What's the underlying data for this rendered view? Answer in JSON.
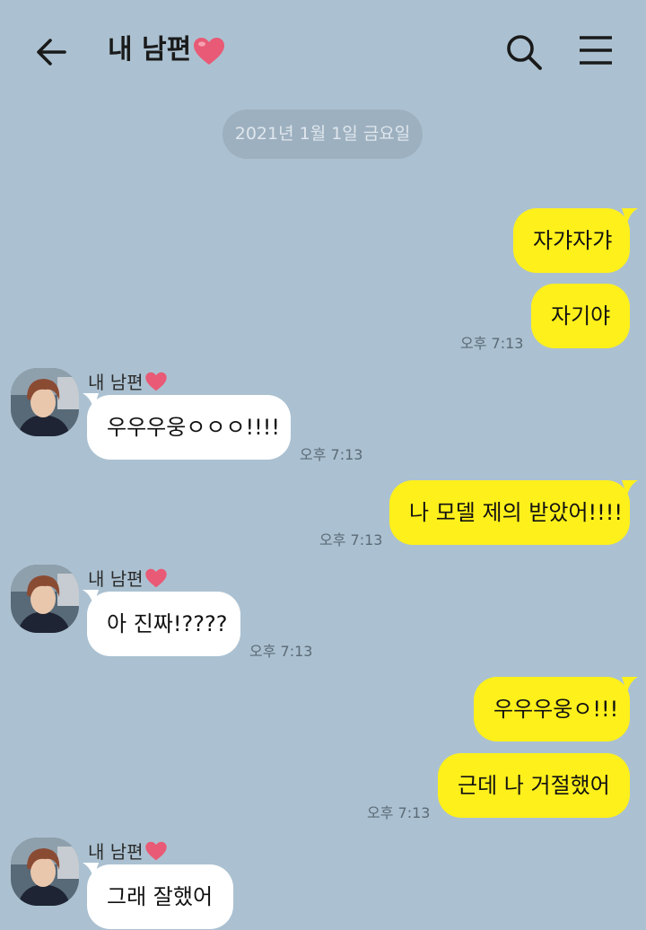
{
  "header": {
    "title": "내 남편",
    "heart_color": "#e85a75"
  },
  "date_divider": "2021년 1월 1일 금요일",
  "colors": {
    "background": "#abc1d1",
    "my_bubble": "#fef01b",
    "their_bubble": "#ffffff"
  },
  "messages": [
    {
      "from": "me",
      "text": "자갸자갸",
      "time": ""
    },
    {
      "from": "me",
      "text": "자기야",
      "time": "오후 7:13"
    },
    {
      "from": "them",
      "sender": "내 남편",
      "text": "우우우웅ㅇㅇㅇ!!!!",
      "time": "오후 7:13"
    },
    {
      "from": "me",
      "text": "나 모델 제의 받았어!!!!",
      "time": "오후 7:13"
    },
    {
      "from": "them",
      "sender": "내 남편",
      "text": "아 진짜!????",
      "time": "오후 7:13"
    },
    {
      "from": "me",
      "text": "우우우웅ㅇ!!!",
      "time": ""
    },
    {
      "from": "me",
      "text": "근데 나 거절했어",
      "time": "오후 7:13"
    },
    {
      "from": "them",
      "sender": "내 남편",
      "text": "그래 잘했어",
      "time": ""
    }
  ]
}
